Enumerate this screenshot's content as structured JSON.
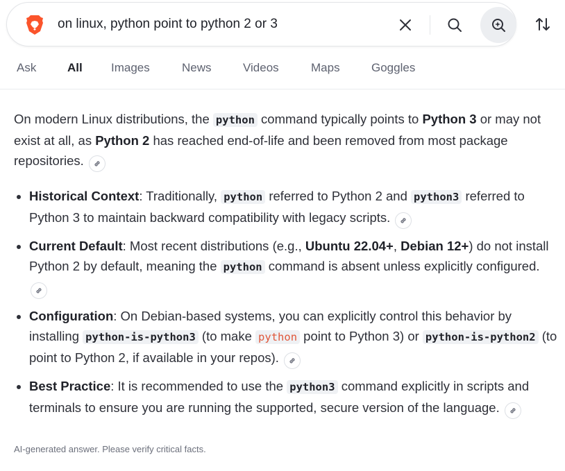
{
  "search": {
    "query": "on linux, python point to python 2 or 3"
  },
  "tabs": [
    {
      "label": "Ask"
    },
    {
      "label": "All"
    },
    {
      "label": "Images"
    },
    {
      "label": "News"
    },
    {
      "label": "Videos"
    },
    {
      "label": "Maps"
    },
    {
      "label": "Goggles"
    }
  ],
  "active_tab": "All",
  "answer": {
    "intro": {
      "t1": "On modern Linux distributions, the ",
      "c1": "python",
      "t2": " command typically points to ",
      "b1": "Python 3",
      "t3": " or may not exist at all, as ",
      "b2": "Python 2",
      "t4": " has reached end-of-life and been removed from most package repositories."
    },
    "bullets": [
      {
        "title": "Historical Context",
        "t1": ": Traditionally, ",
        "c1": "python",
        "t2": " referred to Python 2 and ",
        "c2": "python3",
        "t3": " referred to Python 3 to maintain backward compatibility with legacy scripts."
      },
      {
        "title": "Current Default",
        "t1": ": Most recent distributions (e.g., ",
        "b1": "Ubuntu 22.04+",
        "t2": ", ",
        "b2": "Debian 12+",
        "t3": ") do not install Python 2 by default, meaning the ",
        "c1": "python",
        "t4": " command is absent unless explicitly configured."
      },
      {
        "title": "Configuration",
        "t1": ": On Debian-based systems, you can explicitly control this behavior by installing ",
        "c1": "python-is-python3",
        "t2": " (to make ",
        "c2": "python",
        "t3": " point to Python 3) or ",
        "c3": "python-is-python2",
        "t4": " (to point to Python 2, if available in your repos)."
      },
      {
        "title": "Best Practice",
        "t1": ": It is recommended to use the ",
        "c1": "python3",
        "t2": " command explicitly in scripts and terminals to ensure you are running the supported, secure version of the language."
      }
    ]
  },
  "footer_note": "AI-generated answer. Please verify critical facts.",
  "colors": {
    "accent_code": "#e0573a",
    "brave_orange": "#fb542b",
    "code_bg": "#eff1f4"
  }
}
